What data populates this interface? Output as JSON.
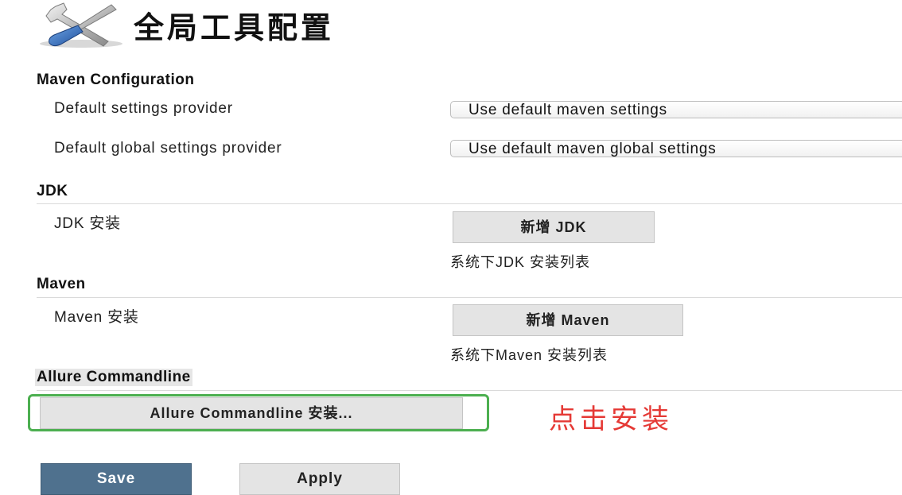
{
  "header": {
    "title": "全局工具配置",
    "icon": "tools-icon"
  },
  "maven_config": {
    "section_title": "Maven Configuration",
    "settings_label": "Default settings provider",
    "settings_value": "Use default maven settings",
    "global_label": "Default global settings provider",
    "global_value": "Use default maven global settings"
  },
  "jdk": {
    "section_title": "JDK",
    "install_label": "JDK 安装",
    "add_button": "新增 JDK",
    "hint": "系统下JDK 安装列表"
  },
  "maven": {
    "section_title": "Maven",
    "install_label": "Maven 安装",
    "add_button": "新增 Maven",
    "hint": "系统下Maven 安装列表"
  },
  "allure": {
    "section_title": "Allure Commandline",
    "install_button": "Allure Commandline 安装...",
    "annotation": "点击安装",
    "annotation_color": "#e53935",
    "frame_color": "#4caf50"
  },
  "actions": {
    "save_label": "Save",
    "apply_label": "Apply",
    "save_color": "#4f718e"
  }
}
